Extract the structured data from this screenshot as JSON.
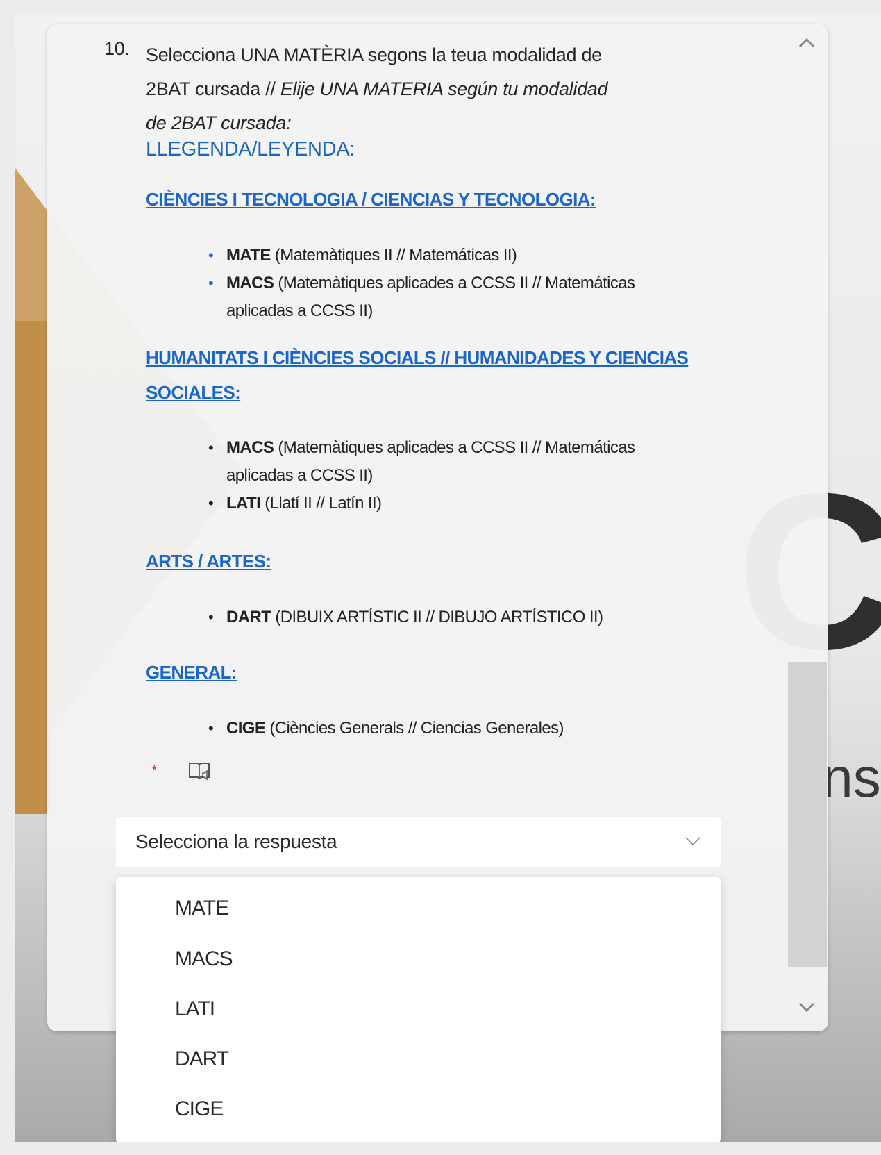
{
  "question": {
    "number": "10.",
    "text_line1": "Selecciona UNA MATÈRIA segons la teua modalidad de",
    "text_line2_normal": "2BAT cursada // ",
    "text_line2_italic": "Elije UNA MATERIA según tu modalidad",
    "text_line3_italic": "de 2BAT cursada:",
    "legend_title": "LLEGENDA/LEYENDA:"
  },
  "sections": [
    {
      "heading": "CIÈNCIES I TECNOLOGIA / CIENCIAS Y TECNOLOGIA:",
      "items": [
        {
          "code": "MATE",
          "desc": " (Matemàtiques II // Matemáticas II)"
        },
        {
          "code": "MACS",
          "desc": " (Matemàtiques aplicades a CCSS II // Matemáticas aplicadas a CCSS II)"
        }
      ]
    },
    {
      "heading": "HUMANITATS I CIÈNCIES SOCIALS // HUMANIDADES Y CIENCIAS SOCIALES:",
      "items": [
        {
          "code": "MACS",
          "desc": " (Matemàtiques aplicades a CCSS II // Matemáticas aplicadas a CCSS II)"
        },
        {
          "code": "LATI",
          "desc": " (Llatí II // Latín II)"
        }
      ]
    },
    {
      "heading": "ARTS / ARTES:",
      "items": [
        {
          "code": "DART",
          "desc": " (DIBUIX ARTÍSTIC II // DIBUJO ARTÍSTICO II)"
        }
      ]
    },
    {
      "heading": "GENERAL:",
      "items": [
        {
          "code": "CIGE",
          "desc": " (Ciències Generals // Ciencias Generales)"
        }
      ]
    }
  ],
  "required_marker": "*",
  "select": {
    "placeholder": "Selecciona la respuesta",
    "options": [
      "MATE",
      "MACS",
      "LATI",
      "DART",
      "CIGE"
    ]
  },
  "background": {
    "logo_text": "CAR",
    "logo_subtext": "Institut d'Educ"
  },
  "colors": {
    "link_blue": "#1a66c9",
    "required_red": "#c4314b",
    "card_bg": "#f3f3f3"
  },
  "icons": {
    "immersive_reader": "immersive-reader-icon",
    "chevron_down": "chevron-down-icon",
    "scroll_up": "scroll-up-icon",
    "scroll_down": "scroll-down-icon"
  }
}
